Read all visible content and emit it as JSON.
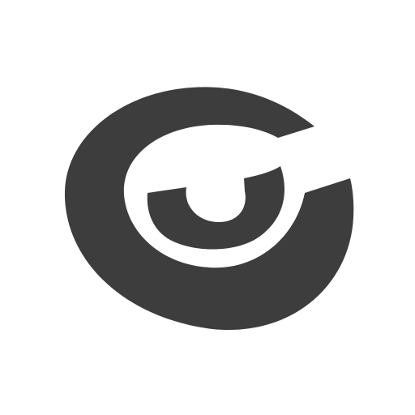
{
  "icon": {
    "name": "eye-c-logo-icon",
    "color": "#3d3d3d",
    "background": "#ffffff"
  }
}
